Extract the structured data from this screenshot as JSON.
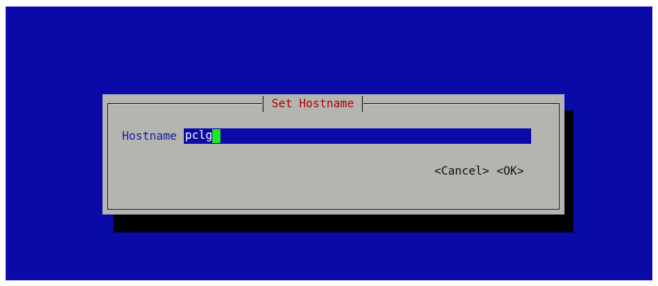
{
  "dialog": {
    "title": "Set Hostname",
    "field_label": "Hostname",
    "field_value": "pclg",
    "cancel_label": "<Cancel>",
    "ok_label": "<OK>"
  },
  "colors": {
    "screen_background": "#0a0aa8",
    "dialog_background": "#b4b4b0",
    "title_text": "#b00000",
    "label_text": "#1a1aa0",
    "input_background": "#0a0aa8",
    "cursor": "#22e822"
  }
}
